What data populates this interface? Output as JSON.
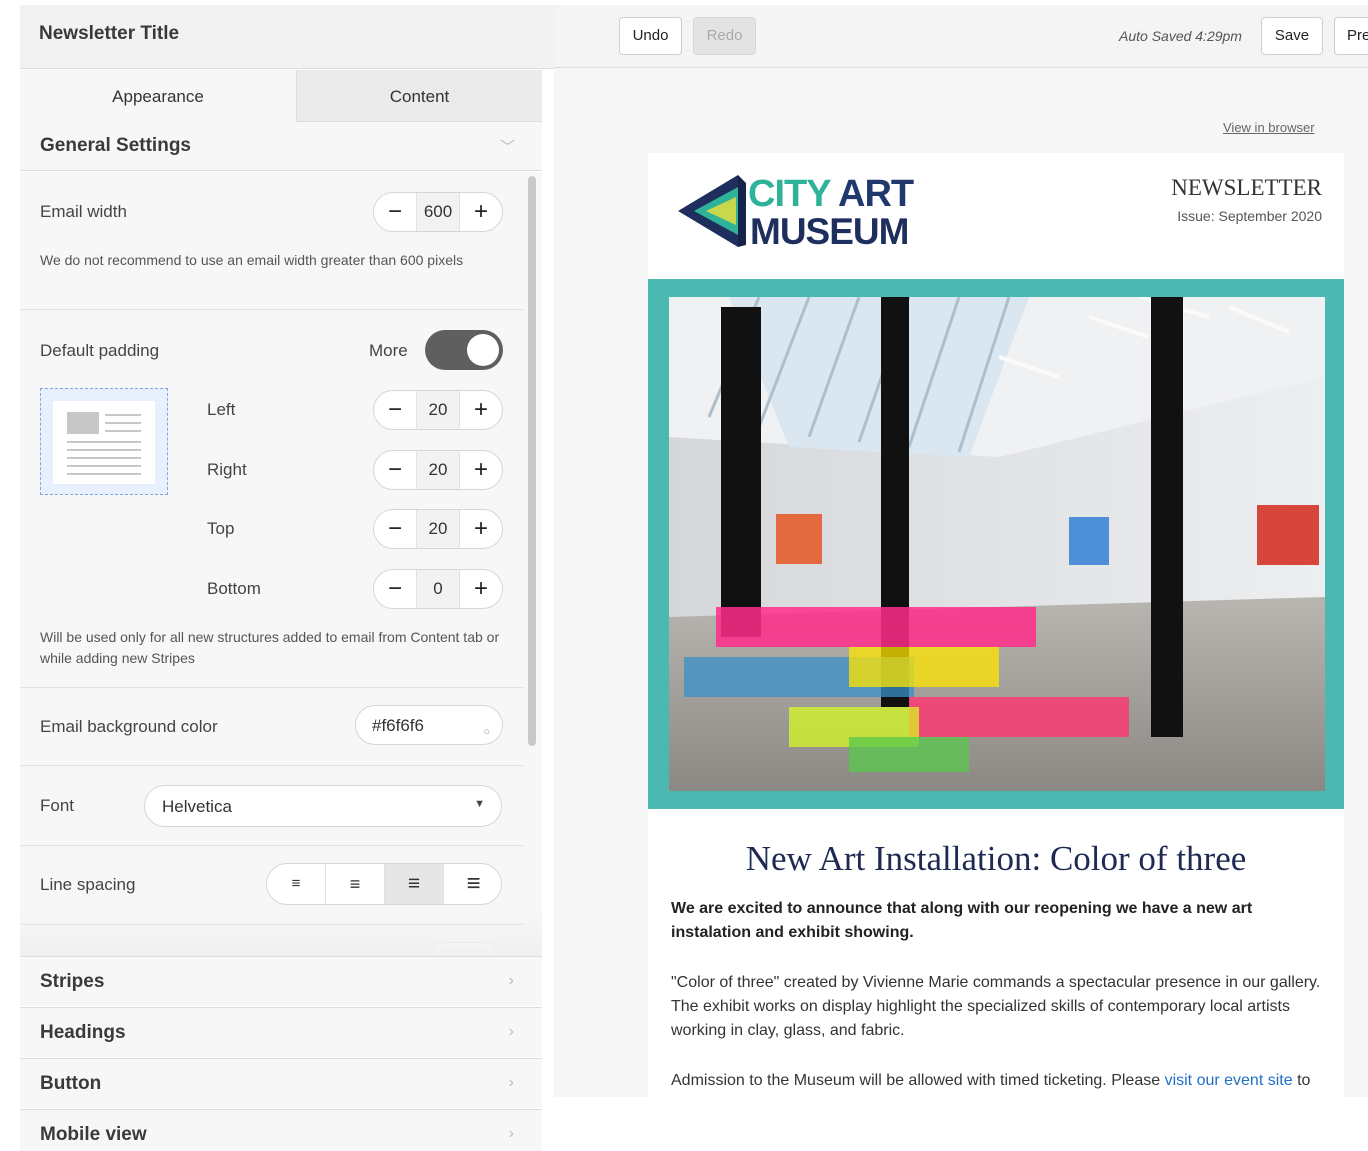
{
  "sidebar": {
    "title": "Newsletter Title",
    "tabs": [
      {
        "label": "Appearance"
      },
      {
        "label": "Content"
      }
    ],
    "general_settings": {
      "header": "General Settings",
      "email_width": {
        "label": "Email width",
        "value": "600"
      },
      "width_note": "We do not recommend to use an email width greater than 600 pixels",
      "default_padding": {
        "label": "Default padding",
        "more_label": "More",
        "left": {
          "label": "Left",
          "value": "20"
        },
        "right": {
          "label": "Right",
          "value": "20"
        },
        "top": {
          "label": "Top",
          "value": "20"
        },
        "bottom": {
          "label": "Bottom",
          "value": "0"
        }
      },
      "padding_note": "Will be used only for all new structures added to email from Content tab or while adding new Stripes",
      "bg_color": {
        "label": "Email background color",
        "value": "#f6f6f6"
      },
      "font": {
        "label": "Font",
        "value": "Helvetica"
      },
      "line_spacing": {
        "label": "Line spacing",
        "options": [
          "≡",
          "≡",
          "≡",
          "≡"
        ],
        "selected_index": 2
      }
    },
    "sections": [
      {
        "label": "Stripes"
      },
      {
        "label": "Headings"
      },
      {
        "label": "Button"
      },
      {
        "label": "Mobile view"
      }
    ]
  },
  "toolbar": {
    "undo": "Undo",
    "redo": "Redo",
    "autosave": "Auto Saved 4:29pm",
    "save": "Save",
    "preview": "Pre"
  },
  "email": {
    "view_in_browser": "View in browser",
    "logo": {
      "city": "CITY",
      "art": "ART",
      "museum": "MUSEUM"
    },
    "newsletter": "NEWSLETTER",
    "issue": "Issue: September 2020",
    "headline": "New Art Installation: Color of three",
    "lead": "We are excited to announce that along with our reopening we have a new art instalation and exhibit showing.",
    "para1": "\"Color of three\" created by Vivienne Marie commands a spectacular presence in our gallery. The exhibit works on display highlight the specialized skills of contemporary local artists working in clay, glass, and fabric.",
    "para2_text": "Admission to the Museum will be allowed with timed ticketing. Please ",
    "para2_link": "visit our event site",
    "para2_tail": " to"
  },
  "colors": {
    "teal_frame": "#4bb9b1",
    "canvas_bg": "#f6f6f6",
    "logo_teal": "#2eb39a",
    "logo_navy": "#1e2f5e",
    "link": "#1f6fc7"
  }
}
